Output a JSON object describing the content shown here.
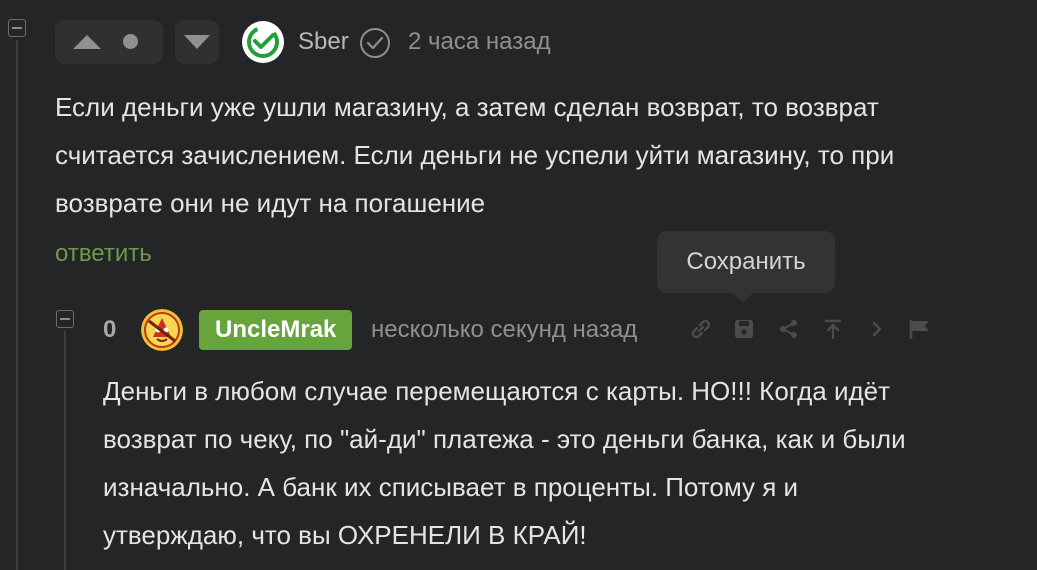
{
  "comment_1": {
    "author": "Sber",
    "timestamp": "2 часа назад",
    "lines": [
      "Если деньги уже ушли магазину, а затем сделан возврат, то возврат",
      "считается зачислением. Если деньги не успели уйти магазину, то при",
      "возврате они не идут на погашение"
    ],
    "reply_label": "ответить"
  },
  "tooltip": {
    "text": "Сохранить"
  },
  "comment_2": {
    "rating": "0",
    "author": "UncleMrak",
    "timestamp": "несколько секунд назад",
    "lines": [
      "Деньги в любом случае перемещаются с карты. НО!!! Когда идёт",
      "возврат по чеку, по \"ай-ди\" платежа - это деньги банка, как и были",
      "изначально. А банк их списывает в проценты. Потому я и",
      "утверждаю, что вы ОХРЕНЕЛИ В КРАЙ!"
    ]
  },
  "colors": {
    "background": "#242526",
    "badge_green": "#67a53c",
    "reply_green": "#6e9a4e",
    "sber_green": "#21a038"
  },
  "icons": [
    "collapse-icon",
    "vote-up-icon",
    "vote-down-icon",
    "verified-icon",
    "link-icon",
    "save-icon",
    "share-icon",
    "pin-icon",
    "arrow-icon",
    "flag-icon"
  ]
}
